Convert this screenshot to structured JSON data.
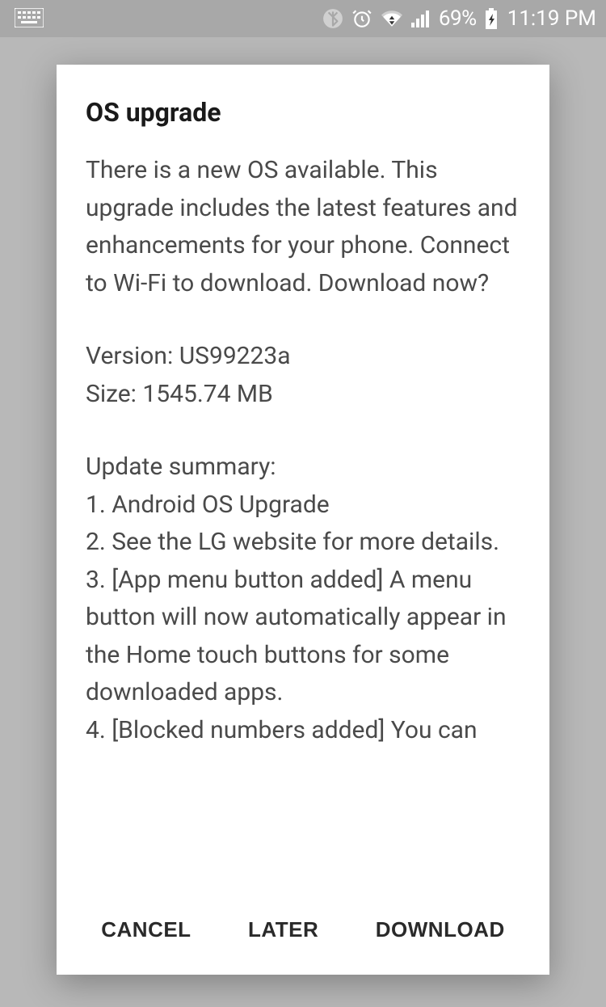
{
  "statusBar": {
    "batteryPercent": "69%",
    "time": "11:19 PM"
  },
  "dialog": {
    "title": "OS upgrade",
    "body": {
      "intro": "There is a new OS available. This upgrade includes the latest features and enhancements for your phone. Connect to Wi-Fi to download. Download now?",
      "versionLine": "Version: US99223a",
      "sizeLine": "Size: 1545.74 MB",
      "summaryHeader": "Update summary:",
      "item1": "1. Android OS Upgrade",
      "item2": "2. See the LG website for more details.",
      "item3": "3. [App menu button added] A menu button will now automatically appear in the Home touch buttons for some downloaded apps.",
      "item4": "4. [Blocked numbers added] You can"
    },
    "actions": {
      "cancel": "CANCEL",
      "later": "LATER",
      "download": "DOWNLOAD"
    }
  }
}
